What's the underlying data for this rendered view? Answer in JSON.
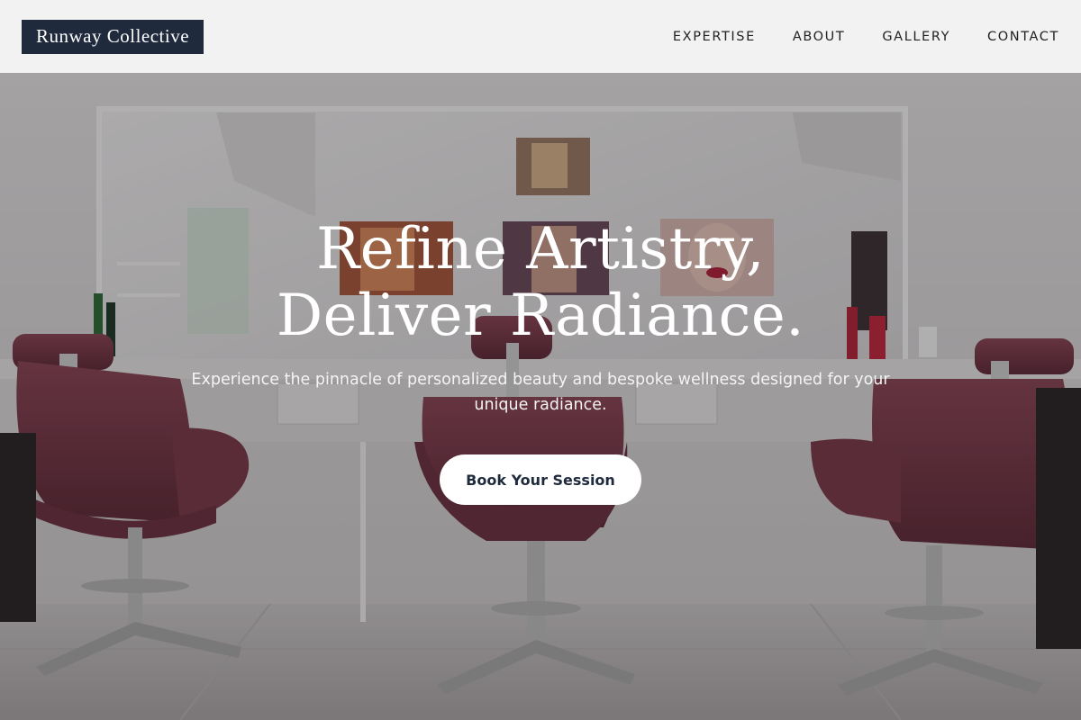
{
  "brand": {
    "name": "Runway Collective"
  },
  "nav": {
    "items": [
      {
        "label": "EXPERTISE"
      },
      {
        "label": "ABOUT"
      },
      {
        "label": "GALLERY"
      },
      {
        "label": "CONTACT"
      }
    ]
  },
  "hero": {
    "headline_line1": "Refine Artistry,",
    "headline_line2": "Deliver Radiance.",
    "subtitle": "Experience the pinnacle of personalized beauty and bespoke wellness designed for your unique radiance.",
    "cta_label": "Book Your Session",
    "background": "salon-interior-photo"
  },
  "colors": {
    "brand_navy": "#1f2a3d",
    "header_bg": "#f2f2f3",
    "chair_burgundy": "#7a3a48",
    "cta_bg": "#ffffff"
  }
}
